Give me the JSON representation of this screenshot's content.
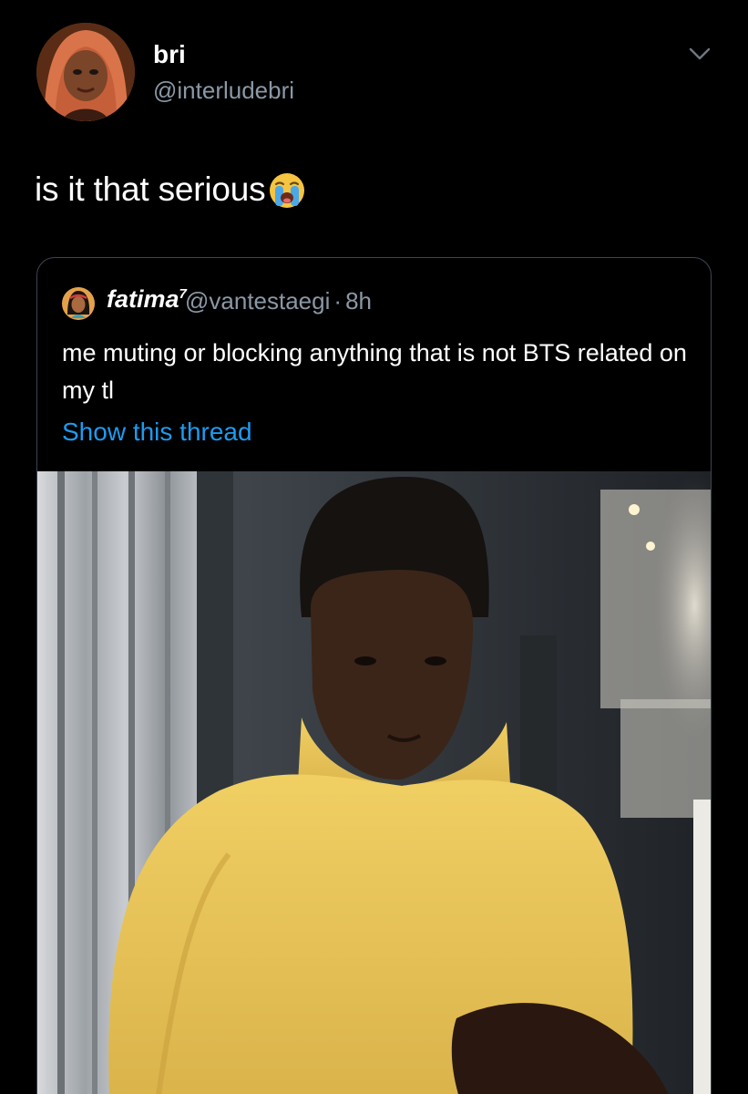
{
  "author": {
    "name": "bri",
    "handle": "@interludebri",
    "avatar_icon": "profile-photo"
  },
  "tweet": {
    "text": "is it that serious",
    "emoji_icon": "loudly-crying-face-emoji"
  },
  "menu": {
    "icon": "chevron-down-icon"
  },
  "quoted": {
    "name": "fatima",
    "name_superscript": "7",
    "handle": "@vantestaegi",
    "separator": "·",
    "time": "8h",
    "text": "me muting or blocking anything that is not BTS related on my tl",
    "show_thread": "Show this thread",
    "media_icon": "video-still"
  },
  "colors": {
    "background": "#000000",
    "secondary_text": "#8b98a5",
    "link": "#1d9bf0",
    "border": "#3d4550"
  }
}
